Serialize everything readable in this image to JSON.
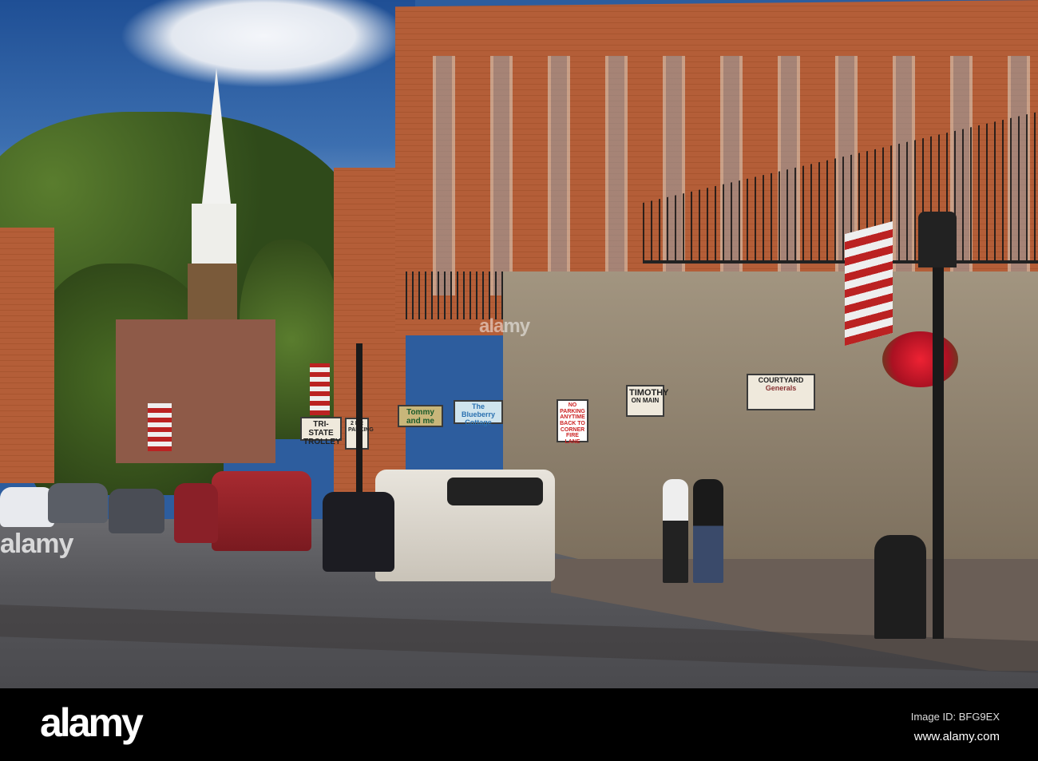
{
  "photo": {
    "subject": "Main street with brick storefronts, church steeple and parked cars"
  },
  "signs": {
    "trolley": "TRI-STATE TROLLEY",
    "parking_small": "2 HR PARKING",
    "tommy": "Tommy and me",
    "blueberry": "The Blueberry Cottage",
    "no_parking": "NO PARKING ANYTIME BACK TO CORNER FIRE LANE",
    "timothy": "TIMOTHY",
    "timothy_sub": "ON MAIN",
    "courtyard": "COURTYARD",
    "generals": "Generals"
  },
  "watermark": {
    "mark": "alamy",
    "center": "alamy"
  },
  "footer": {
    "logo": "alamy",
    "image_id": "Image ID: BFG9EX",
    "url": "www.alamy.com"
  }
}
